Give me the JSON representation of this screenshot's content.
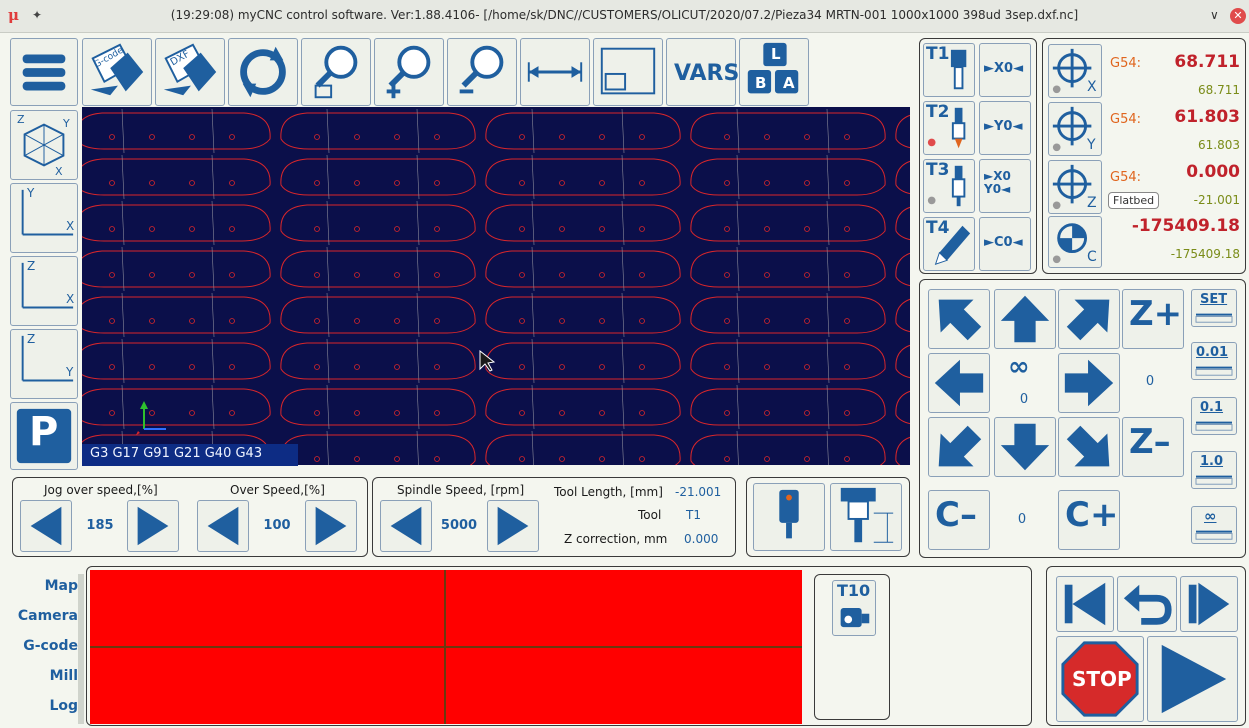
{
  "window": {
    "title": "(19:29:08) myCNC control software. Ver:1.88.4106- [/home/sk/DNC//CUSTOMERS/OLICUT/2020/07.2/Pieza34 MRTN-001 1000x1000 398ud 3sep.dxf.nc]",
    "logo": "μ",
    "pin_icon": "pin-icon",
    "minimize": "∨",
    "close": "✕"
  },
  "toolbar": {
    "gcode_label": "G-code",
    "dxf_label": "DXF",
    "vars_label": "VARS",
    "keys_labels": [
      "L",
      "B",
      "A"
    ]
  },
  "views": {
    "xyz_labels": [
      "Z",
      "Y",
      "X"
    ],
    "xy": [
      "Y",
      "X"
    ],
    "zx": [
      "Z",
      "X"
    ],
    "zy": [
      "Z",
      "Y"
    ],
    "park": "P"
  },
  "gcodes": "G3  G17  G91  G21  G40  G43",
  "tools": [
    {
      "label": "T1",
      "zero": "►X0◄"
    },
    {
      "label": "T2",
      "zero": "►Y0◄"
    },
    {
      "label": "T3",
      "zero": "►X0 Y0◄"
    },
    {
      "label": "T4",
      "zero": "►C0◄"
    }
  ],
  "coordinates": [
    {
      "axis": "X",
      "wcs": "G54:",
      "value": "68.711",
      "machine": "68.711"
    },
    {
      "axis": "Y",
      "wcs": "G54:",
      "value": "61.803",
      "machine": "61.803"
    },
    {
      "axis": "Z",
      "wcs": "G54:",
      "value": "0.000",
      "machine": "-21.001",
      "badge": "Flatbed"
    },
    {
      "axis": "C",
      "wcs": "",
      "value": "-175409.18",
      "machine": "-175409.18"
    }
  ],
  "jog": {
    "infinity": "∞",
    "xy_step": "0",
    "z_step": "0",
    "c_step": "0",
    "z_plus": "Z+",
    "z_minus": "Z–",
    "c_minus": "C–",
    "c_plus": "C+",
    "step_buttons": [
      "SET",
      "0.01",
      "0.1",
      "1.0",
      "∞"
    ]
  },
  "speeds": {
    "jog_over_label": "Jog over speed,[%]",
    "jog_over_value": "185",
    "over_label": "Over Speed,[%]",
    "over_value": "100",
    "spindle_label": "Spindle Speed, [rpm]",
    "spindle_value": "5000",
    "tool_length_label": "Tool Length, [mm]",
    "tool_length_value": "-21.001",
    "tool_label": "Tool",
    "tool_value": "T1",
    "zcorr_label": "Z correction, mm",
    "zcorr_value": "0.000"
  },
  "bottom_tabs": [
    "Map",
    "Camera",
    "G-code",
    "Mill",
    "Log"
  ],
  "camera_tool": "T10",
  "controls": {
    "stop": "STOP"
  },
  "colors": {
    "accent": "#1f5f9f",
    "viewport": "#0b0f4a",
    "path": "#d8262b",
    "map": "#ff0000"
  }
}
